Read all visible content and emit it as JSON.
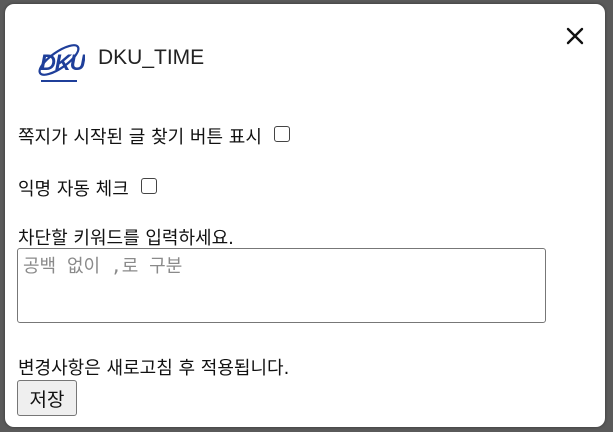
{
  "app": {
    "title": "DKU_TIME",
    "logo_text": "DKU"
  },
  "colors": {
    "brand": "#1f3f9a"
  },
  "settings": {
    "show_note_button_label": "쪽지가 시작된 글 찾기 버튼 표시",
    "anonymous_check_label": "익명 자동 체크",
    "block_keywords_label": "차단할 키워드를 입력하세요.",
    "block_keywords_placeholder": "공백 없이 ,로 구분",
    "note": "변경사항은 새로고침 후 적용됩니다.",
    "save_label": "저장"
  }
}
